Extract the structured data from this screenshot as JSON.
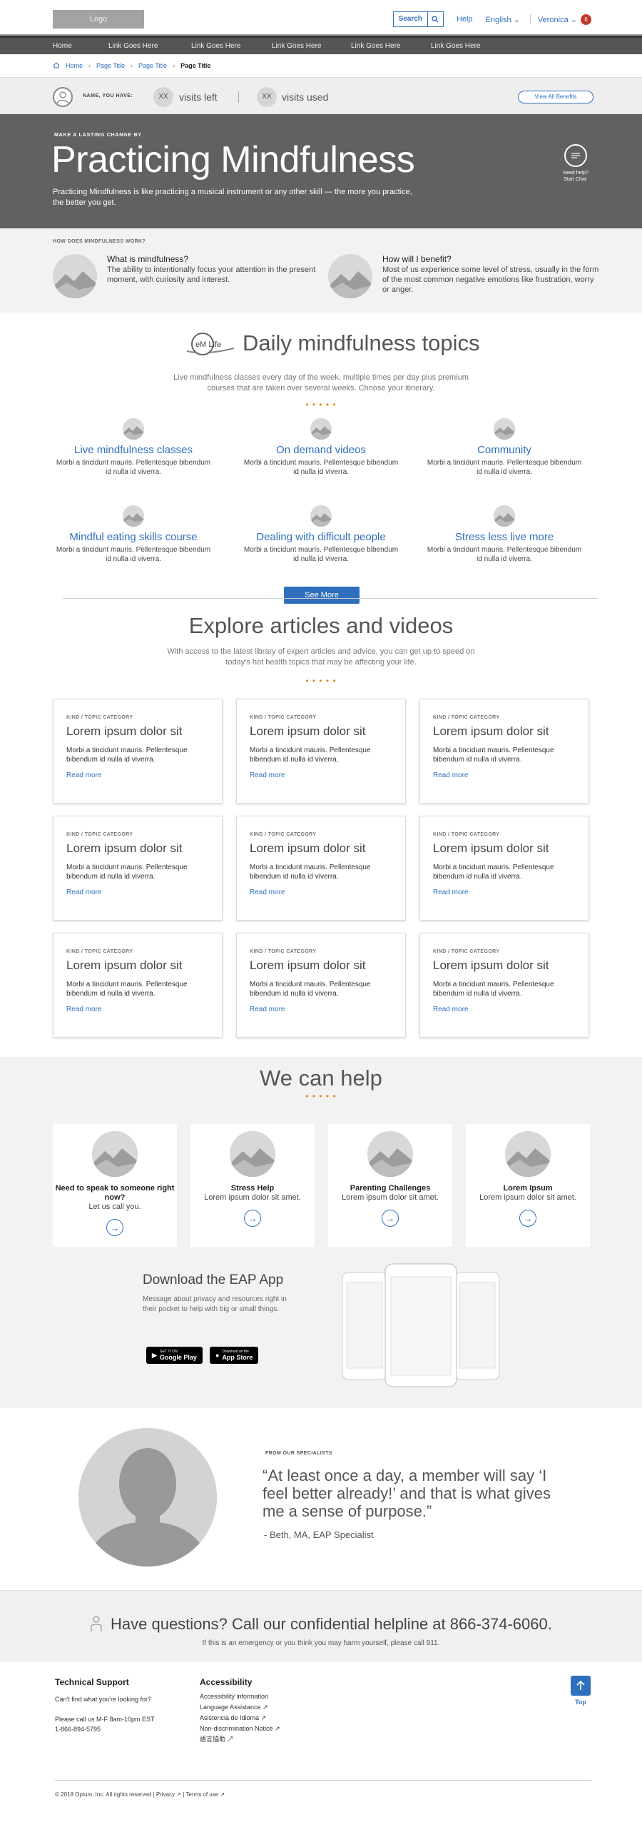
{
  "header": {
    "logo": "Logo",
    "search_label": "Search",
    "help": "Help",
    "language": "English",
    "user": "Veronica",
    "notifications": "6"
  },
  "nav": [
    "Home",
    "Link Goes Here",
    "Link Goes Here",
    "Link Goes Here",
    "Link Goes Here",
    "Link Goes Here"
  ],
  "breadcrumb": [
    "Home",
    "Page Title",
    "Page Title",
    "Page Title"
  ],
  "visits": {
    "label": "NAME, YOU HAVE:",
    "left_count": "XX",
    "left_text": "visits left",
    "used_count": "XX",
    "used_text": "visits used",
    "button": "View All Benefits"
  },
  "hero": {
    "kicker": "MAKE A LASTING CHANGE BY",
    "title": "Practicing Mindfulness",
    "text": "Practicing Mindfulness is like practicing a musical instrument or any other skill — the more you practice, the better you get.",
    "chat_line1": "Need help?",
    "chat_line2": "Start Chat."
  },
  "how": {
    "label": "HOW DOES MINDFULNESS WORK?",
    "items": [
      {
        "title": "What is mindfulness?",
        "text": "The ability to intentionally focus your attention in the present moment, with curiosity and interest."
      },
      {
        "title": "How will I benefit?",
        "text": "Most of us experience some level of stress, usually in the form of the most common negative emotions like frustration, worry or anger."
      }
    ]
  },
  "topics": {
    "logo_text": "eM Life",
    "title": "Daily mindfulness topics",
    "subtitle": "Live mindfulness classes every day of the week, multiple times per day plus premium courses that are taken over several weeks.  Choose your itinerary.",
    "items": [
      {
        "title": "Live mindfulness classes",
        "text": "Morbi a tincidunt mauris. Pellentesque bibendum id nulla id viverra."
      },
      {
        "title": "On demand videos",
        "text": "Morbi a tincidunt mauris. Pellentesque bibendum id nulla id viverra."
      },
      {
        "title": "Community",
        "text": "Morbi a tincidunt mauris. Pellentesque bibendum id nulla id viverra."
      },
      {
        "title": "Mindful eating skills course",
        "text": "Morbi a tincidunt mauris. Pellentesque bibendum id nulla id viverra."
      },
      {
        "title": "Dealing with difficult people",
        "text": "Morbi a tincidunt mauris. Pellentesque bibendum id nulla id viverra."
      },
      {
        "title": "Stress less live more",
        "text": "Morbi a tincidunt mauris. Pellentesque bibendum id nulla id viverra."
      }
    ],
    "button": "See More"
  },
  "articles": {
    "title": "Explore articles and videos",
    "subtitle": "With access to the latest library of expert articles and advice, you can get up to speed on today's hot health topics that may be affecting your life.",
    "items": [
      {
        "kind": "KIND / TOPIC CATEGORY",
        "title": "Lorem ipsum dolor sit",
        "text": "Morbi a tincidunt mauris. Pellentesque bibendum id nulla id viverra.",
        "link": "Read more"
      },
      {
        "kind": "KIND / TOPIC CATEGORY",
        "title": "Lorem ipsum dolor sit",
        "text": "Morbi a tincidunt mauris. Pellentesque bibendum id nulla id viverra.",
        "link": "Read more"
      },
      {
        "kind": "KIND / TOPIC CATEGORY",
        "title": "Lorem ipsum dolor sit",
        "text": "Morbi a tincidunt mauris. Pellentesque bibendum id nulla id viverra.",
        "link": "Read more"
      },
      {
        "kind": "KIND / TOPIC CATEGORY",
        "title": "Lorem ipsum dolor sit",
        "text": "Morbi a tincidunt mauris. Pellentesque bibendum id nulla id viverra.",
        "link": "Read more"
      },
      {
        "kind": "KIND / TOPIC CATEGORY",
        "title": "Lorem ipsum dolor sit",
        "text": "Morbi a tincidunt mauris. Pellentesque bibendum id nulla id viverra.",
        "link": "Read more"
      },
      {
        "kind": "KIND / TOPIC CATEGORY",
        "title": "Lorem ipsum dolor sit",
        "text": "Morbi a tincidunt mauris. Pellentesque bibendum id nulla id viverra.",
        "link": "Read more"
      },
      {
        "kind": "KIND / TOPIC CATEGORY",
        "title": "Lorem ipsum dolor sit",
        "text": "Morbi a tincidunt mauris. Pellentesque bibendum id nulla id viverra.",
        "link": "Read more"
      },
      {
        "kind": "KIND / TOPIC CATEGORY",
        "title": "Lorem ipsum dolor sit",
        "text": "Morbi a tincidunt mauris. Pellentesque bibendum id nulla id viverra.",
        "link": "Read more"
      },
      {
        "kind": "KIND / TOPIC CATEGORY",
        "title": "Lorem ipsum dolor sit",
        "text": "Morbi a tincidunt mauris. Pellentesque bibendum id nulla id viverra.",
        "link": "Read more"
      }
    ]
  },
  "help": {
    "title": "We can help",
    "items": [
      {
        "title": "Need to speak to someone right now?",
        "text": "Let us call you."
      },
      {
        "title": "Stress Help",
        "text": "Lorem ipsum dolor sit amet."
      },
      {
        "title": "Parenting Challenges",
        "text": "Lorem ipsum dolor sit amet."
      },
      {
        "title": "Lorem Ipsum",
        "text": "Lorem ipsum dolor sit amet."
      }
    ]
  },
  "app": {
    "title": "Download the EAP App",
    "text": "Message about privacy and resources right in their pocket to help with big or small things.",
    "google_small": "GET IT ON",
    "google": "Google Play",
    "apple_small": "Download on the",
    "apple": "App Store"
  },
  "quote": {
    "label": "FROM OUR SPECIALISTS",
    "text": "“At least once a day, a member will say ‘I feel better already!’ and that is what gives me a sense of purpose.”",
    "author": "- Beth, MA, EAP Specialist"
  },
  "cta": {
    "title": "Have questions? Call our confidential helpline at 866-374-6060.",
    "note": "If this is an emergency or you think you may harm yourself, please call 911."
  },
  "footer": {
    "support_title": "Technical Support",
    "support_q": "Can't find what you're looking for?",
    "support_hours": "Please call us M-F 8am-10pm EST",
    "support_phone": "1-866-894-5795",
    "access_title": "Accessibility",
    "access_links": [
      "Accessibility information",
      "Language Assistance",
      "Asistencia de Idioma",
      "Non-discrimination Notice",
      "語言協助"
    ],
    "top": "Top",
    "copyright": "© 2018 Optum, Inc. All rights reserved",
    "privacy": "Privacy",
    "terms": "Terms of use"
  },
  "colors": {
    "accent": "#2f6fbd",
    "hero": "#616161",
    "dots": "#e08a1e",
    "badge": "#c0392b"
  }
}
